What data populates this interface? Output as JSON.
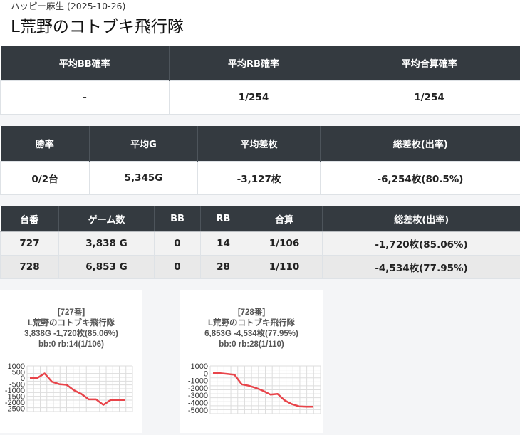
{
  "header": {
    "store_line": "ハッピー麻生 (2025-10-26)",
    "machine_title": "L荒野のコトブキ飛行隊"
  },
  "summary_rates": {
    "headers": [
      "平均BB確率",
      "平均RB確率",
      "平均合算確率"
    ],
    "values": [
      "-",
      "1/254",
      "1/254"
    ]
  },
  "summary_totals": {
    "headers": [
      "勝率",
      "平均G",
      "平均差枚",
      "総差枚(出率)"
    ],
    "values": [
      "0/2台",
      "5,345G",
      "-3,127枚",
      "-6,254枚(80.5%)"
    ]
  },
  "machines": {
    "headers": [
      "台番",
      "ゲーム数",
      "BB",
      "RB",
      "合算",
      "総差枚(出率)"
    ],
    "rows": [
      [
        "727",
        "3,838 G",
        "0",
        "14",
        "1/106",
        "-1,720枚(85.06%)"
      ],
      [
        "728",
        "6,853 G",
        "0",
        "28",
        "1/110",
        "-4,534枚(77.95%)"
      ]
    ]
  },
  "colors": {
    "header_bg": "#343a40",
    "line": "#e8444a",
    "grid": "#dddddd"
  },
  "chart_data": [
    {
      "type": "line",
      "caption": [
        "[727番]",
        "L荒野のコトブキ飛行隊",
        "3,838G -1,720枚(85.06%)",
        "bb:0 rb:14(1/106)"
      ],
      "yticks": [
        "1000",
        "500",
        "0",
        "-500",
        "-1000",
        "-1500",
        "-2000",
        "-2500"
      ],
      "ylim": [
        -2750,
        1000
      ],
      "values": [
        0,
        0,
        380,
        -300,
        -500,
        -550,
        -1000,
        -1300,
        -1750,
        -1750,
        -2200,
        -1800,
        -1800,
        -1800
      ],
      "grid": true
    },
    {
      "type": "line",
      "caption": [
        "[728番]",
        "L荒野のコトブキ飛行隊",
        "6,853G -4,534枚(77.95%)",
        "bb:0 rb:28(1/110)"
      ],
      "yticks": [
        "1000",
        "0",
        "-1000",
        "-2000",
        "-3000",
        "-4000",
        "-5000"
      ],
      "ylim": [
        -5500,
        1000
      ],
      "values": [
        0,
        0,
        -100,
        -200,
        -1500,
        -1700,
        -2000,
        -2400,
        -2900,
        -2800,
        -3700,
        -4200,
        -4500,
        -4550,
        -4550
      ],
      "grid": true
    }
  ]
}
